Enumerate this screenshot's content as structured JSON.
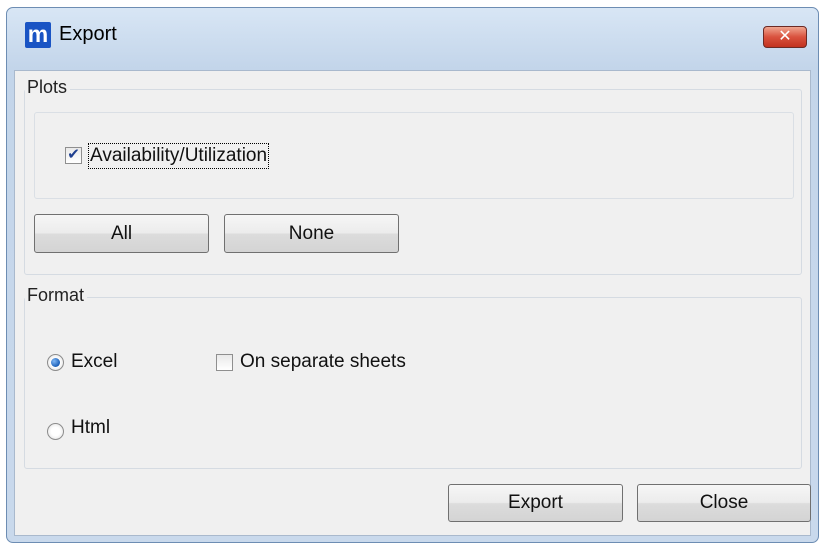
{
  "window": {
    "title": "Export",
    "app_icon_glyph": "m",
    "close_glyph": "✕"
  },
  "plots": {
    "legend": "Plots",
    "items": [
      {
        "label": "Availability/Utilization",
        "checked": true
      }
    ],
    "all_label": "All",
    "none_label": "None"
  },
  "format": {
    "legend": "Format",
    "excel_label": "Excel",
    "excel_selected": true,
    "separate_label": "On separate sheets",
    "separate_checked": false,
    "html_label": "Html",
    "html_selected": false
  },
  "footer": {
    "export_label": "Export",
    "close_label": "Close"
  },
  "colors": {
    "accent": "#1a54c4",
    "close_button": "#c2321f"
  }
}
